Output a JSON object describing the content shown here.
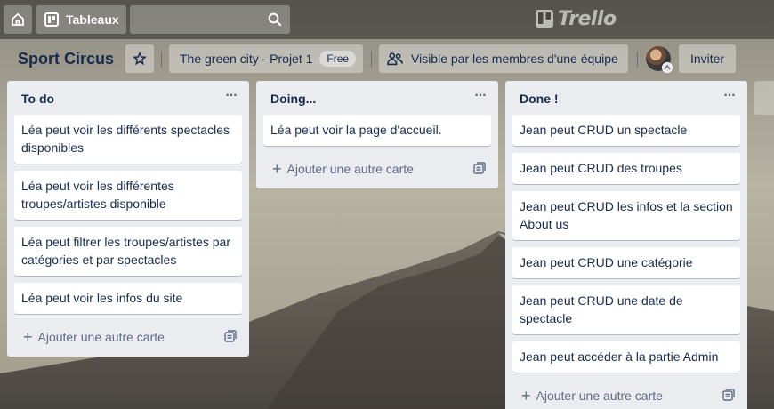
{
  "topbar": {
    "boards_label": "Tableaux",
    "search_value": "",
    "logo_text": "Trello"
  },
  "board": {
    "title": "Sport Circus",
    "team_name": "The green city - Projet 1",
    "plan_badge": "Free",
    "visibility_label": "Visible par les membres d'une équipe",
    "invite_label": "Inviter"
  },
  "lists": [
    {
      "title": "To do",
      "cards": [
        "Léa peut voir les différents spectacles disponibles",
        "Léa peut voir les différentes troupes/artistes disponible",
        "Léa peut filtrer les troupes/artistes par catégories et par spectacles",
        "Léa peut voir les infos du site"
      ],
      "add_label": "Ajouter une autre carte"
    },
    {
      "title": "Doing...",
      "cards": [
        "Léa peut voir la page d'accueil."
      ],
      "add_label": "Ajouter une autre carte"
    },
    {
      "title": "Done !",
      "cards": [
        "Jean peut CRUD un spectacle",
        "Jean peut CRUD des troupes",
        "Jean peut CRUD les infos et la section About us",
        "Jean peut CRUD une catégorie",
        "Jean peut CRUD une date de spectacle",
        "Jean peut accéder à la partie Admin"
      ],
      "add_label": "Ajouter une autre carte"
    }
  ],
  "icons": {
    "home": "home-icon",
    "boards": "boards-icon",
    "search": "search-icon",
    "star": "star-icon",
    "visibility": "team-visibility-icon",
    "list_menu": "more-icon",
    "add": "plus-icon",
    "template": "card-template-icon"
  },
  "colors": {
    "list_bg": "#ebecf0",
    "card_bg": "#ffffff",
    "text": "#172b4d",
    "muted": "#5e6c84"
  }
}
